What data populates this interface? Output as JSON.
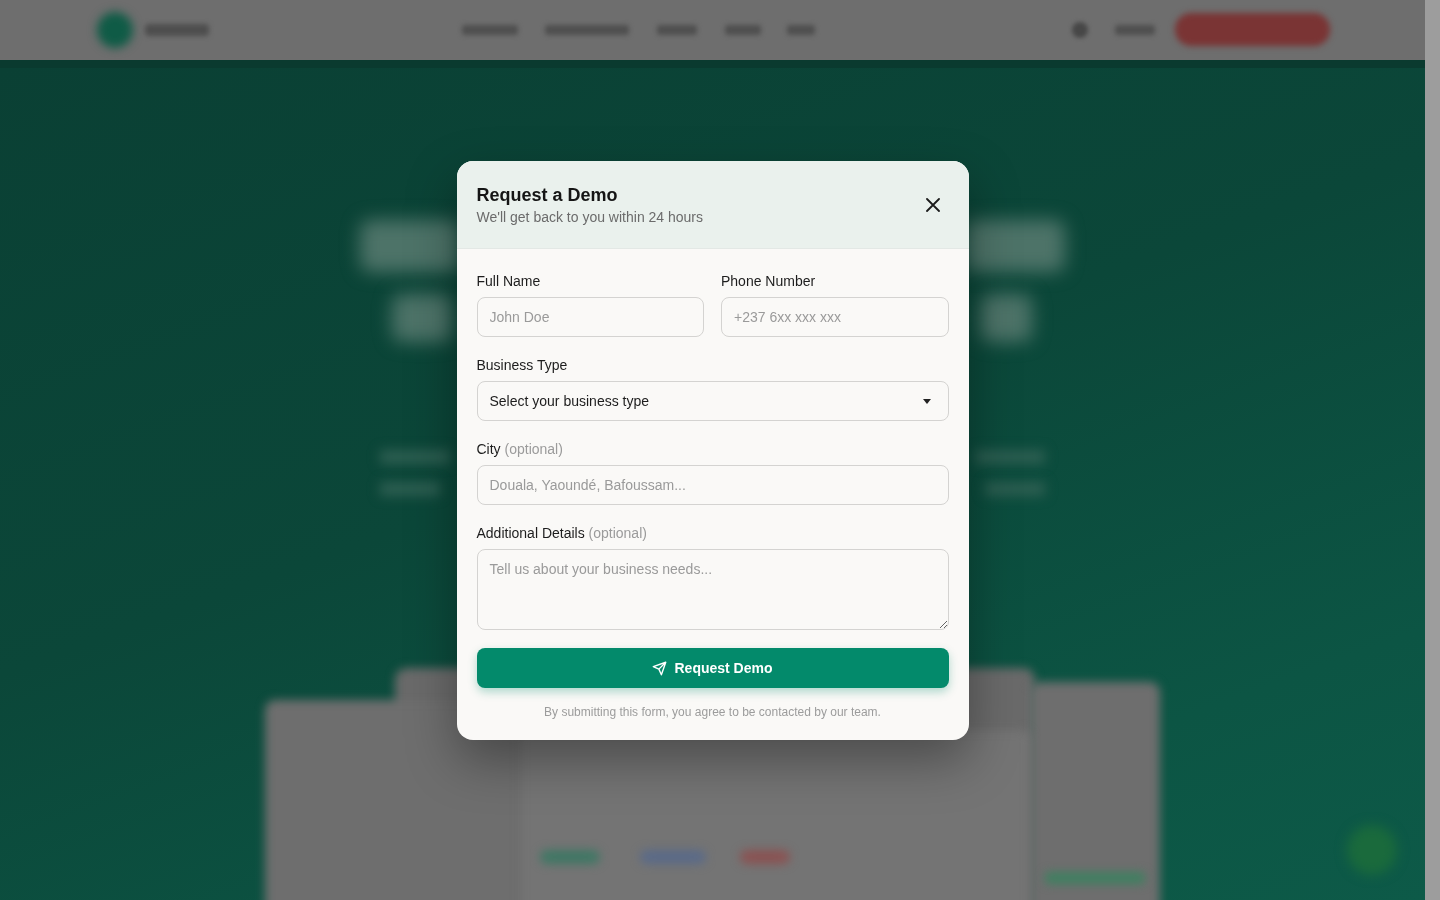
{
  "modal": {
    "title": "Request a Demo",
    "subtitle": "We'll get back to you within 24 hours"
  },
  "form": {
    "rows": [
      [
        {
          "kind": "text",
          "label": "Full Name",
          "placeholder": "John Doe"
        },
        {
          "kind": "text",
          "label": "Phone Number",
          "placeholder": "+237 6xx xxx xxx"
        }
      ],
      [
        {
          "kind": "select",
          "label": "Business Type",
          "value": "Select your business type"
        }
      ],
      [
        {
          "kind": "text",
          "label": "City",
          "note": "(optional)",
          "placeholder": "Douala, Yaoundé, Bafoussam..."
        }
      ],
      [
        {
          "kind": "textarea",
          "label": "Additional Details",
          "note": "(optional)",
          "placeholder": "Tell us about your business needs..."
        }
      ]
    ]
  },
  "submit": {
    "label": "Request Demo"
  },
  "disclaimer": "By submitting this form, you agree to be contacted by our team."
}
